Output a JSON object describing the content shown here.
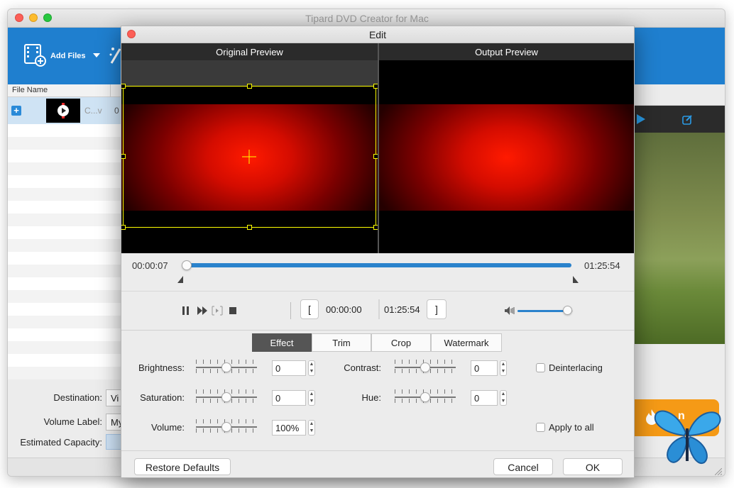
{
  "main_window": {
    "title": "Tipard DVD Creator for Mac",
    "toolbar": {
      "add_files_label": "Add Files"
    },
    "file_list": {
      "column_header": "File Name",
      "item_name": "C...v",
      "item_extra": "0"
    },
    "bottom": {
      "destination_label": "Destination:",
      "destination_value": "Vi",
      "volume_label_label": "Volume Label:",
      "volume_label_value": "My",
      "capacity_label": "Estimated Capacity:",
      "burn_label": "n"
    }
  },
  "edit_dialog": {
    "title": "Edit",
    "original_preview_label": "Original Preview",
    "output_preview_label": "Output Preview",
    "timeline": {
      "current_time": "00:00:07",
      "duration": "01:25:54",
      "progress": 1.0
    },
    "playback": {
      "start_time": "00:00:00",
      "end_time": "01:25:54",
      "volume_level": 0.9
    },
    "tabs": [
      {
        "label": "Effect",
        "active": true
      },
      {
        "label": "Trim",
        "active": false
      },
      {
        "label": "Crop",
        "active": false
      },
      {
        "label": "Watermark",
        "active": false
      }
    ],
    "effect": {
      "brightness": {
        "label": "Brightness:",
        "value": "0",
        "level": 0.5
      },
      "contrast": {
        "label": "Contrast:",
        "value": "0",
        "level": 0.5
      },
      "saturation": {
        "label": "Saturation:",
        "value": "0",
        "level": 0.5
      },
      "hue": {
        "label": "Hue:",
        "value": "0",
        "level": 0.5
      },
      "volume": {
        "label": "Volume:",
        "value": "100%",
        "level": 0.5
      },
      "deinterlacing": {
        "label": "Deinterlacing",
        "checked": false
      },
      "apply_to_all": {
        "label": "Apply to all",
        "checked": false
      }
    },
    "buttons": {
      "restore": "Restore Defaults",
      "cancel": "Cancel",
      "ok": "OK"
    }
  },
  "colors": {
    "accent_blue": "#1f7fcf",
    "progress_blue": "#2a82cc",
    "active_tab": "#555555",
    "burn_orange": "#f59a16",
    "close_red": "#fc5f57"
  },
  "icons": [
    "film-add-icon",
    "dropdown-arrow-icon",
    "play-icon",
    "edit-icon",
    "pause-icon",
    "fast-forward-icon",
    "next-frame-icon",
    "stop-icon",
    "speaker-icon",
    "fire-icon",
    "butterfly-logo"
  ]
}
